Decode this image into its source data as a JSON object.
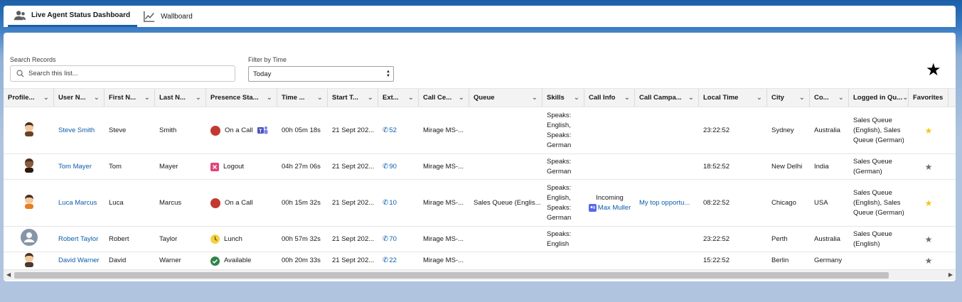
{
  "tabs": [
    {
      "label": "Live Agent Status Dashboard",
      "icon": "users-icon",
      "active": true
    },
    {
      "label": "Wallboard",
      "icon": "line-chart-icon",
      "active": false
    }
  ],
  "search": {
    "label": "Search Records",
    "placeholder": "Search this list..."
  },
  "filter": {
    "label": "Filter by Time",
    "value": "Today"
  },
  "columns": [
    "Profile...",
    "User N...",
    "First N...",
    "Last N...",
    "Presence Sta...",
    "Time ...",
    "Start T...",
    "Ext...",
    "Call Ce...",
    "Queue",
    "Skills",
    "Call Info",
    "Call Campa...",
    "Local Time",
    "City",
    "Co...",
    "Logged in Qu...",
    "Favorites"
  ],
  "rows": [
    {
      "avatar": "man-with-beard-avatar",
      "user": "Steve Smith",
      "first": "Steve",
      "last": "Smith",
      "presence": "On a Call",
      "presence_color": "#c23934",
      "teams": true,
      "time": "00h 05m 18s",
      "start": "21 Sept 202...",
      "ext": "52",
      "callcenter": "Mirage MS-...",
      "queue": "",
      "skills": "Speaks: English, Speaks: German",
      "callinfo_status": "",
      "callinfo_contact": "",
      "campaign": "",
      "localtime": "23:22:52",
      "city": "Sydney",
      "country": "Australia",
      "loggedin": "Sales Queue (English), Sales Queue (German)",
      "favorite": true
    },
    {
      "avatar": "man-dark-beard-avatar",
      "user": "Tom Mayer",
      "first": "Tom",
      "last": "Mayer",
      "presence": "Logout",
      "presence_color": "#e3427a",
      "teams": false,
      "time": "04h 27m 06s",
      "start": "21 Sept 202...",
      "ext": "90",
      "callcenter": "Mirage MS-...",
      "queue": "",
      "skills": "Speaks: German",
      "callinfo_status": "",
      "callinfo_contact": "",
      "campaign": "",
      "localtime": "18:52:52",
      "city": "New Delhi",
      "country": "India",
      "loggedin": "Sales Queue (German)",
      "favorite": false
    },
    {
      "avatar": "man-orange-shirt-avatar",
      "user": "Luca Marcus",
      "first": "Luca",
      "last": "Marcus",
      "presence": "On a Call",
      "presence_color": "#c23934",
      "teams": false,
      "time": "00h 15m 32s",
      "start": "21 Sept 202...",
      "ext": "10",
      "callcenter": "Mirage MS-...",
      "queue": "Sales Queue (Englis...",
      "skills": "Speaks: English, Speaks: German",
      "callinfo_status": "Incoming",
      "callinfo_contact": "Max Muller",
      "campaign": "My top opportu...",
      "localtime": "08:22:52",
      "city": "Chicago",
      "country": "USA",
      "loggedin": "Sales Queue (English), Sales Queue (German)",
      "favorite": true
    },
    {
      "avatar": "default-user-avatar",
      "user": "Robert Taylor",
      "first": "Robert",
      "last": "Taylor",
      "presence": "Lunch",
      "presence_color": "#f4d03f",
      "teams": false,
      "time": "00h 57m 32s",
      "start": "21 Sept 202...",
      "ext": "70",
      "callcenter": "Mirage MS-...",
      "queue": "",
      "skills": "Speaks: English",
      "callinfo_status": "",
      "callinfo_contact": "",
      "campaign": "",
      "localtime": "23:22:52",
      "city": "Perth",
      "country": "Australia",
      "loggedin": "Sales Queue (English)",
      "favorite": false
    },
    {
      "avatar": "man-suit-avatar",
      "user": "David Warner",
      "first": "David",
      "last": "Warner",
      "presence": "Available",
      "presence_color": "#2e844a",
      "teams": false,
      "time": "00h 20m 33s",
      "start": "21 Sept 202...",
      "ext": "22",
      "callcenter": "Mirage MS-...",
      "queue": "",
      "skills": "",
      "callinfo_status": "",
      "callinfo_contact": "",
      "campaign": "",
      "localtime": "15:22:52",
      "city": "Berlin",
      "country": "Germany",
      "loggedin": "",
      "favorite": false
    }
  ],
  "colors": {
    "brand": "#1b5fa8",
    "link": "#0b5cab",
    "star_on": "#f5c518"
  }
}
